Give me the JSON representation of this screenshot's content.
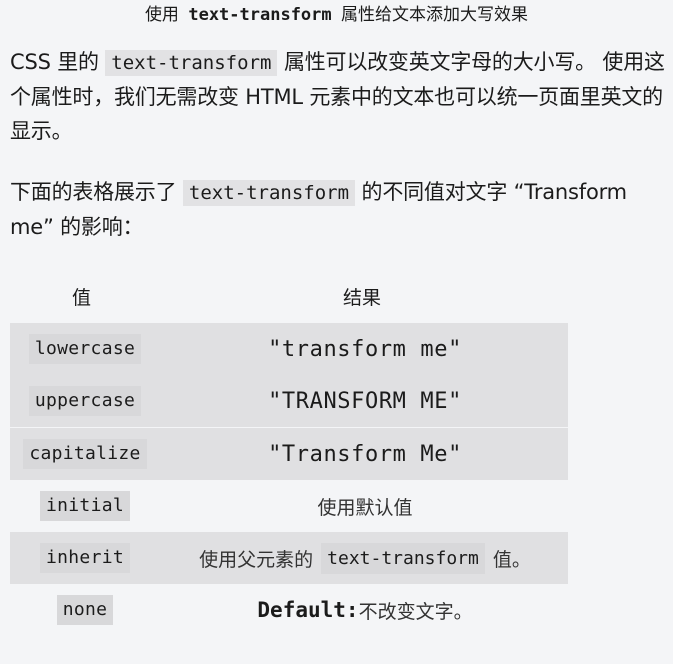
{
  "title": {
    "prefix": "使用",
    "code": "text-transform",
    "suffix": "属性给文本添加大写效果"
  },
  "intro": {
    "before": "CSS 里的",
    "code": "text-transform",
    "after": "属性可以改变英文字母的大小写。 使用这个属性时，我们无需改变 HTML 元素中的文本也可以统一页面里英文的显示。"
  },
  "lead": {
    "before": "下面的表格展示了",
    "code": "text-transform",
    "after": "的不同值对文字 “Transform me” 的影响："
  },
  "table": {
    "headers": {
      "value": "值",
      "result": "结果"
    },
    "rows": [
      {
        "value": "lowercase",
        "result": "\"transform me\""
      },
      {
        "value": "uppercase",
        "result": "\"TRANSFORM ME\""
      },
      {
        "value": "capitalize",
        "result": "\"Transform Me\""
      },
      {
        "value": "initial",
        "result": "使用默认值"
      },
      {
        "value": "inherit",
        "result_before": "使用父元素的",
        "result_code": "text-transform",
        "result_after": "值。"
      },
      {
        "value": "none",
        "result_strong": "Default:",
        "result_after": "不改变文字。"
      }
    ]
  }
}
